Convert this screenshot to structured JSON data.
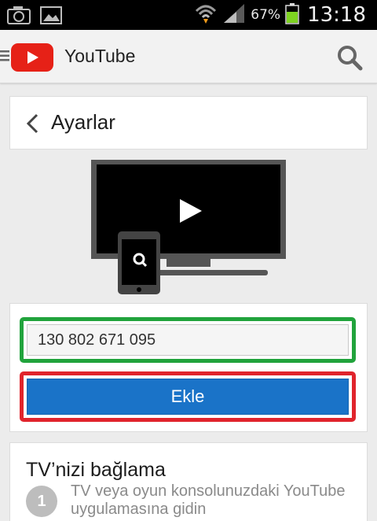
{
  "status_bar": {
    "battery_percent": "67%",
    "time": "13:18",
    "icons": [
      "camera-icon",
      "gallery-icon",
      "wifi-icon",
      "signal-icon",
      "battery-icon"
    ]
  },
  "app_bar": {
    "title": "YouTube",
    "icons": [
      "menu-icon",
      "youtube-logo",
      "search-icon"
    ],
    "brand_color": "#e62117"
  },
  "settings": {
    "title": "Ayarlar"
  },
  "pair_form": {
    "code_value": "130 802 671 095",
    "add_button_label": "Ekle",
    "input_highlight_color": "#21a33c",
    "button_highlight_color": "#e0242c",
    "button_color": "#1a73c8"
  },
  "help": {
    "title": "TV’nizi bağlama",
    "steps": [
      {
        "number": "1",
        "text": "TV veya oyun konsolunuzdaki YouTube uygulamasına gidin"
      }
    ]
  }
}
